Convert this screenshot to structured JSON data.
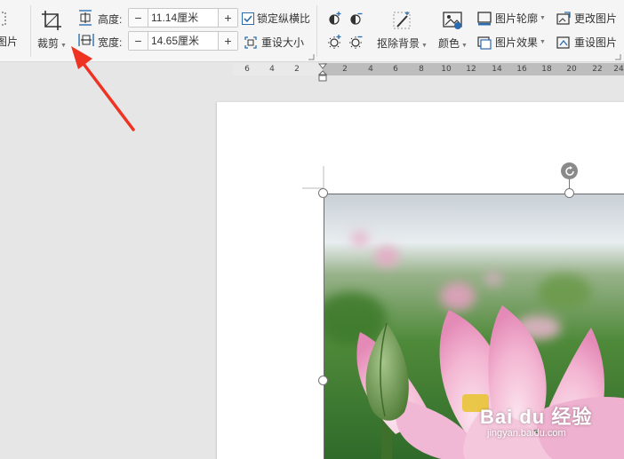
{
  "ribbon": {
    "partial_left_label": "图片",
    "crop_label": "裁剪",
    "height": {
      "label": "高度:",
      "value": "11.14厘米"
    },
    "width": {
      "label": "宽度:",
      "value": "14.65厘米"
    },
    "lock_aspect_label": "锁定纵横比",
    "lock_aspect_checked": true,
    "reset_size_label": "重设大小",
    "remove_bg_label": "抠除背景",
    "color_label": "颜色",
    "outline_label": "图片轮廓",
    "effect_label": "图片效果",
    "change_picture_label": "更改图片",
    "reset_picture_label": "重设图片"
  },
  "ruler": {
    "labels": [
      "6",
      "4",
      "2",
      "2",
      "4",
      "6",
      "8",
      "10",
      "12",
      "14",
      "16",
      "18",
      "20",
      "22",
      "24"
    ]
  },
  "watermark": {
    "brand": "Bai du 经验",
    "url": "jingyan.baidu.com"
  },
  "colors": {
    "accent": "#2b6cb0",
    "arrow": "#ee3322",
    "ruler_active": "#bdbdbd"
  }
}
